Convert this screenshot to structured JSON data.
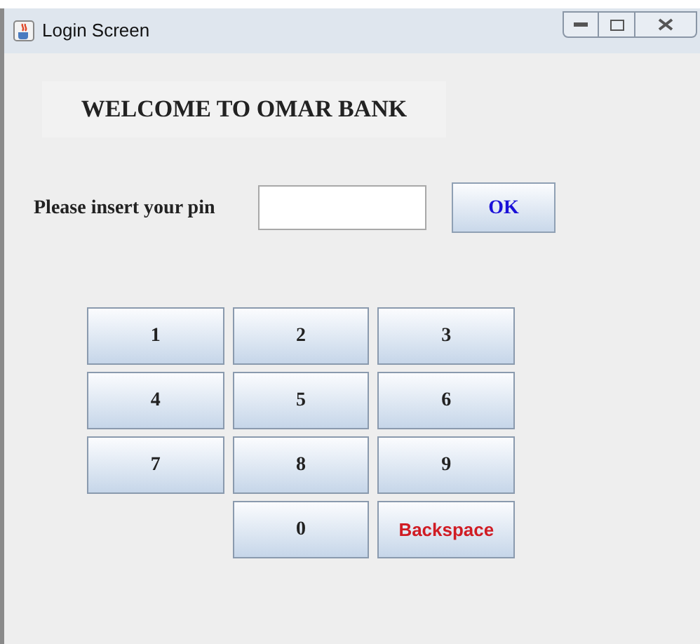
{
  "window": {
    "title": "Login Screen"
  },
  "heading": "WELCOME TO OMAR BANK",
  "pin": {
    "label": "Please insert your pin"
  },
  "ok_button": "OK",
  "keypad": {
    "rows": [
      [
        {
          "kind": "digit",
          "label": "1"
        },
        {
          "kind": "digit",
          "label": "2"
        },
        {
          "kind": "digit",
          "label": "3"
        }
      ],
      [
        {
          "kind": "digit",
          "label": "4"
        },
        {
          "kind": "digit",
          "label": "5"
        },
        {
          "kind": "digit",
          "label": "6"
        }
      ],
      [
        {
          "kind": "digit",
          "label": "7"
        },
        {
          "kind": "digit",
          "label": "8"
        },
        {
          "kind": "digit",
          "label": "9"
        }
      ],
      [
        "",
        {
          "kind": "digit",
          "label": "0"
        },
        {
          "kind": "backspace",
          "label": "Backspace"
        }
      ]
    ]
  }
}
